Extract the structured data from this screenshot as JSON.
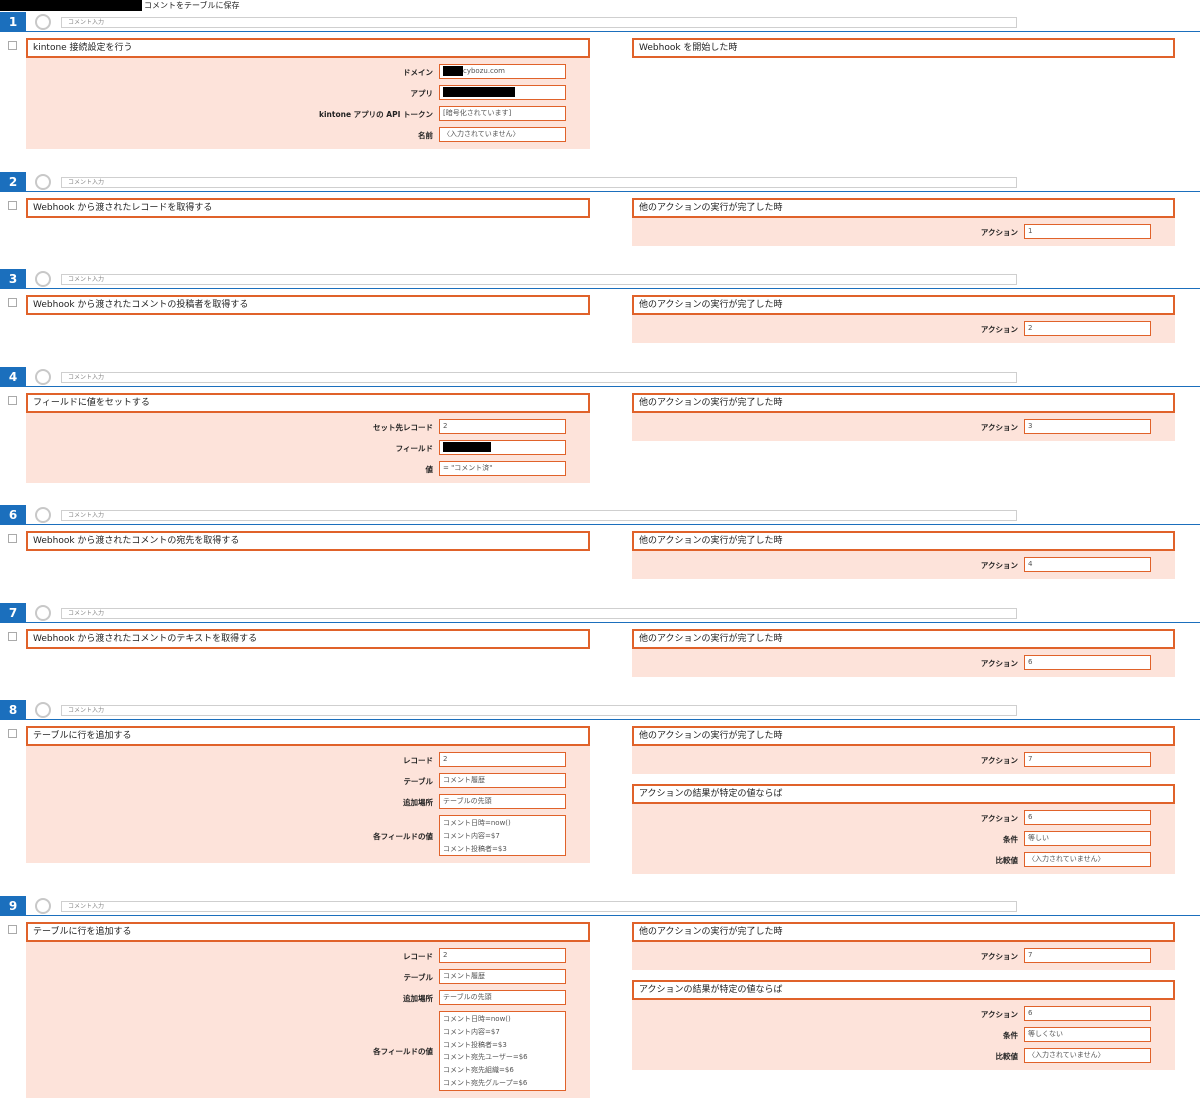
{
  "header": {
    "title": "コメントをテーブルに保存"
  },
  "comment_placeholder": "コメント入力",
  "steps": [
    {
      "num": "1",
      "left": {
        "title": "kintone 接続設定を行う",
        "rows": [
          {
            "label": "ドメイン",
            "value": "cybozu.com"
          },
          {
            "label": "アプリ",
            "value": ""
          },
          {
            "label": "kintone アプリの API トークン",
            "value": "[暗号化されています]"
          },
          {
            "label": "名前",
            "value": "〈入力されていません〉"
          }
        ]
      },
      "right": {
        "title": "Webhook を開始した時"
      }
    },
    {
      "num": "2",
      "left": {
        "title": "Webhook から渡されたレコードを取得する"
      },
      "right": {
        "title": "他のアクションの実行が完了した時",
        "rows": [
          {
            "label": "アクション",
            "value": "1"
          }
        ]
      }
    },
    {
      "num": "3",
      "left": {
        "title": "Webhook から渡されたコメントの投稿者を取得する"
      },
      "right": {
        "title": "他のアクションの実行が完了した時",
        "rows": [
          {
            "label": "アクション",
            "value": "2"
          }
        ]
      }
    },
    {
      "num": "4",
      "left": {
        "title": "フィールドに値をセットする",
        "rows": [
          {
            "label": "セット先レコード",
            "value": "2"
          },
          {
            "label": "フィールド",
            "value": ""
          },
          {
            "label": "値",
            "value": "= \"コメント済\""
          }
        ]
      },
      "right": {
        "title": "他のアクションの実行が完了した時",
        "rows": [
          {
            "label": "アクション",
            "value": "3"
          }
        ]
      }
    },
    {
      "num": "6",
      "left": {
        "title": "Webhook から渡されたコメントの宛先を取得する"
      },
      "right": {
        "title": "他のアクションの実行が完了した時",
        "rows": [
          {
            "label": "アクション",
            "value": "4"
          }
        ]
      }
    },
    {
      "num": "7",
      "left": {
        "title": "Webhook から渡されたコメントのテキストを取得する"
      },
      "right": {
        "title": "他のアクションの実行が完了した時",
        "rows": [
          {
            "label": "アクション",
            "value": "6"
          }
        ]
      }
    },
    {
      "num": "8",
      "left": {
        "title": "テーブルに行を追加する",
        "rows": [
          {
            "label": "レコード",
            "value": "2"
          },
          {
            "label": "テーブル",
            "value": "コメント履歴"
          },
          {
            "label": "追加場所",
            "value": "テーブルの先頭"
          },
          {
            "label": "各フィールドの値",
            "lines": [
              "コメント日時=now()",
              "コメント内容=$7",
              "コメント投稿者=$3"
            ]
          }
        ]
      },
      "right": {
        "title": "他のアクションの実行が完了した時",
        "rows": [
          {
            "label": "アクション",
            "value": "7"
          }
        ]
      },
      "right2": {
        "title": "アクションの結果が特定の値ならば",
        "rows": [
          {
            "label": "アクション",
            "value": "6"
          },
          {
            "label": "条件",
            "value": "等しい"
          },
          {
            "label": "比較値",
            "value": "〈入力されていません〉"
          }
        ]
      }
    },
    {
      "num": "9",
      "left": {
        "title": "テーブルに行を追加する",
        "rows": [
          {
            "label": "レコード",
            "value": "2"
          },
          {
            "label": "テーブル",
            "value": "コメント履歴"
          },
          {
            "label": "追加場所",
            "value": "テーブルの先頭"
          },
          {
            "label": "各フィールドの値",
            "lines": [
              "コメント日時=now()",
              "コメント内容=$7",
              "コメント投稿者=$3",
              "コメント宛先ユーザー=$6",
              "コメント宛先組織=$6",
              "コメント宛先グループ=$6"
            ]
          }
        ]
      },
      "right": {
        "title": "他のアクションの実行が完了した時",
        "rows": [
          {
            "label": "アクション",
            "value": "7"
          }
        ]
      },
      "right2": {
        "title": "アクションの結果が特定の値ならば",
        "rows": [
          {
            "label": "アクション",
            "value": "6"
          },
          {
            "label": "条件",
            "value": "等しくない"
          },
          {
            "label": "比較値",
            "value": "〈入力されていません〉"
          }
        ]
      }
    }
  ]
}
